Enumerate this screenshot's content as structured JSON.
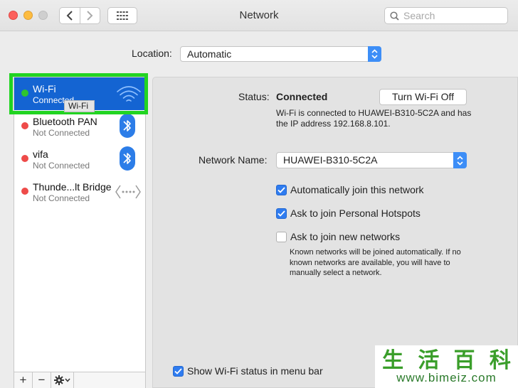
{
  "window": {
    "title": "Network"
  },
  "search": {
    "placeholder": "Search"
  },
  "location": {
    "label": "Location:",
    "value": "Automatic"
  },
  "services": [
    {
      "name": "Wi-Fi",
      "status": "Connected",
      "indicator_color": "#2ec52e",
      "selected": true,
      "icon": "wifi-icon"
    },
    {
      "name": "Bluetooth PAN",
      "status": "Not Connected",
      "indicator_color": "#ee4b49",
      "selected": false,
      "icon": "bluetooth-icon"
    },
    {
      "name": "vifa",
      "status": "Not Connected",
      "indicator_color": "#ee4b49",
      "selected": false,
      "icon": "bluetooth-icon"
    },
    {
      "name": "Thunde...lt Bridge",
      "status": "Not Connected",
      "indicator_color": "#ee4b49",
      "selected": false,
      "icon": "thunderbolt-bridge-icon"
    }
  ],
  "tooltip": "Wi-Fi",
  "footer": {
    "add": "+",
    "remove": "−"
  },
  "detail": {
    "status_label": "Status:",
    "status_value": "Connected",
    "turn_off_label": "Turn Wi-Fi Off",
    "status_description": "Wi-Fi is connected to HUAWEI-B310-5C2A and has the IP address 192.168.8.101.",
    "network_name_label": "Network Name:",
    "network_name_value": "HUAWEI-B310-5C2A",
    "options": [
      {
        "label": "Automatically join this network",
        "checked": true
      },
      {
        "label": "Ask to join Personal Hotspots",
        "checked": true
      },
      {
        "label": "Ask to join new networks",
        "checked": false
      }
    ],
    "known_networks_note": "Known networks will be joined automatically. If no known networks are available, you will have to manually select a network.",
    "menu_bar_label": "Show Wi-Fi status in menu bar",
    "menu_bar_checked": true
  },
  "watermark": {
    "chars": [
      "生",
      "活",
      "百",
      "科"
    ],
    "url": "www.bimeiz.com"
  },
  "colors": {
    "accent": "#3d8ef7",
    "selection": "#1464d2",
    "highlight": "#21d421"
  }
}
